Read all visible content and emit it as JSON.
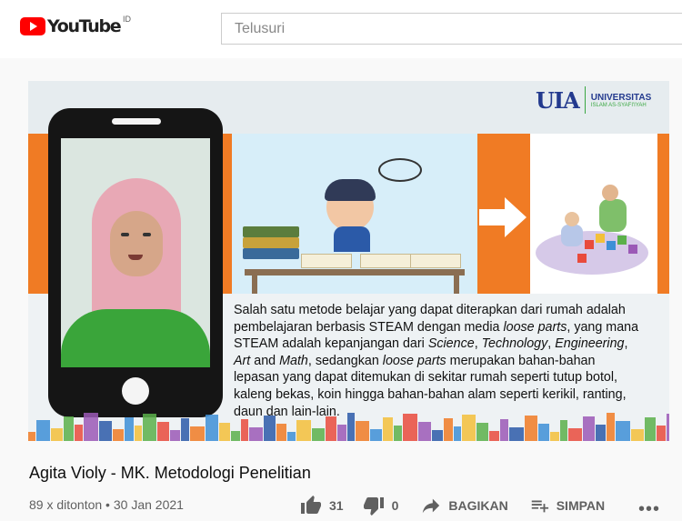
{
  "header": {
    "logo_text": "YouTube",
    "country_code": "ID",
    "search_placeholder": "Telusuri"
  },
  "video": {
    "university_mark": "UIA",
    "university_name": "UNIVERSITAS",
    "university_sub": "ISLAM AS-SYAFI'IYAH",
    "slide_lines": [
      "Salah satu metode belajar yang dapat diterapkan dari rumah adalah",
      "pembelajaran berbasis STEAM dengan media loose parts, yang mana",
      "STEAM adalah kepanjangan dari Science, Technology, Engineering,",
      "Art and Math, sedangkan loose parts merupakan bahan-bahan",
      "lepasan yang dapat  ditemukan di sekitar rumah seperti tutup botol,",
      "kaleng bekas, koin hingga bahan-bahan alam seperti kerikil, ranting,",
      "daun dan lain-lain."
    ]
  },
  "info": {
    "title": "Agita Violy - MK. Metodologi Penelitian",
    "meta": "89 x ditonton • 30 Jan 2021",
    "likes": "31",
    "dislikes": "0",
    "share_label": "BAGIKAN",
    "save_label": "SIMPAN",
    "more_label": "•••"
  },
  "colors": {
    "brand_red": "#ff0000",
    "slide_orange": "#f07b24",
    "meta_gray": "#606060"
  }
}
